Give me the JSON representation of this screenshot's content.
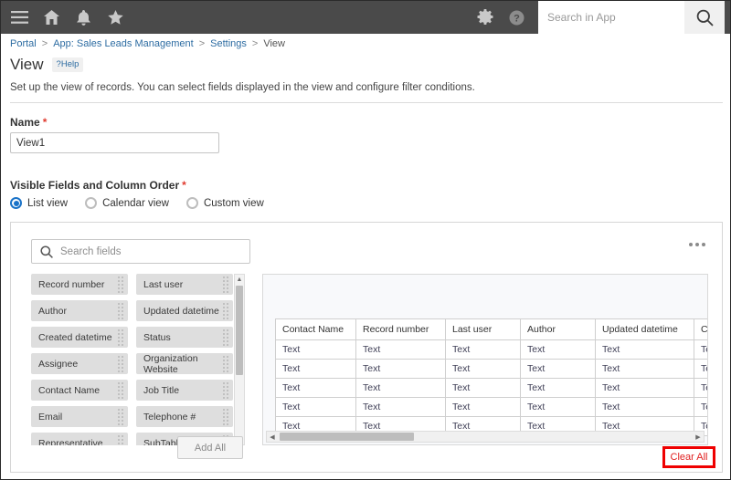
{
  "topbar": {
    "icons": [
      {
        "name": "hamburger-menu-icon",
        "label": "Menu"
      },
      {
        "name": "home-icon",
        "label": "Home"
      },
      {
        "name": "bell-icon",
        "label": "Notifications"
      },
      {
        "name": "star-icon",
        "label": "Favorites"
      }
    ],
    "gear_label": "Settings",
    "help_label": "Help",
    "search_placeholder": "Search in App",
    "search_value": "",
    "search_button_label": "Search",
    "bg_color": "#4a4a4a"
  },
  "breadcrumb": {
    "items": [
      {
        "text": "Portal",
        "link": true
      },
      {
        "text": "App: Sales Leads Management",
        "link": true,
        "prefix": "App:"
      },
      {
        "text": "Settings",
        "link": true
      },
      {
        "text": "View",
        "link": false
      }
    ],
    "separator": ">"
  },
  "header": {
    "title": "View",
    "help_badge": "?Help",
    "description": "Set up the view of records. You can select fields displayed in the view and configure filter conditions."
  },
  "name_field": {
    "label": "Name",
    "required_mark": "*",
    "value": "View1",
    "placeholder": ""
  },
  "visible_fields": {
    "label": "Visible Fields and Column Order",
    "required_mark": "*",
    "view_options": [
      {
        "label": "List view",
        "selected": true
      },
      {
        "label": "Calendar view",
        "selected": false
      },
      {
        "label": "Custom view",
        "selected": false
      }
    ]
  },
  "field_picker": {
    "search_placeholder": "Search fields",
    "search_value": "",
    "menu_label": "More options",
    "column_left": [
      "Record number",
      "Author",
      "Created datetime",
      "Assignee",
      "Contact Name",
      "Email",
      "Representative"
    ],
    "column_right": [
      "Last user",
      "Updated datetime",
      "Status",
      "Organization Website",
      "Job Title",
      "Telephone #",
      "SubTable"
    ],
    "add_all_label": "Add All",
    "clear_all_label": "Clear All",
    "clear_all_color": "#e02020",
    "highlight_color": "#ef0000"
  },
  "preview_table": {
    "columns": [
      "Contact Name",
      "Record number",
      "Last user",
      "Author",
      "Updated datetime",
      "Create"
    ],
    "rows": [
      [
        "Text",
        "Text",
        "Text",
        "Text",
        "Text",
        "Text"
      ],
      [
        "Text",
        "Text",
        "Text",
        "Text",
        "Text",
        "Text"
      ],
      [
        "Text",
        "Text",
        "Text",
        "Text",
        "Text",
        "Text"
      ],
      [
        "Text",
        "Text",
        "Text",
        "Text",
        "Text",
        "Text"
      ],
      [
        "Text",
        "Text",
        "Text",
        "Text",
        "Text",
        "Text"
      ]
    ]
  },
  "colors": {
    "accent_blue": "#1a73c8",
    "link_blue": "#2d6ca2",
    "required_red": "#e03b2f",
    "chip_gray": "#dedede"
  }
}
